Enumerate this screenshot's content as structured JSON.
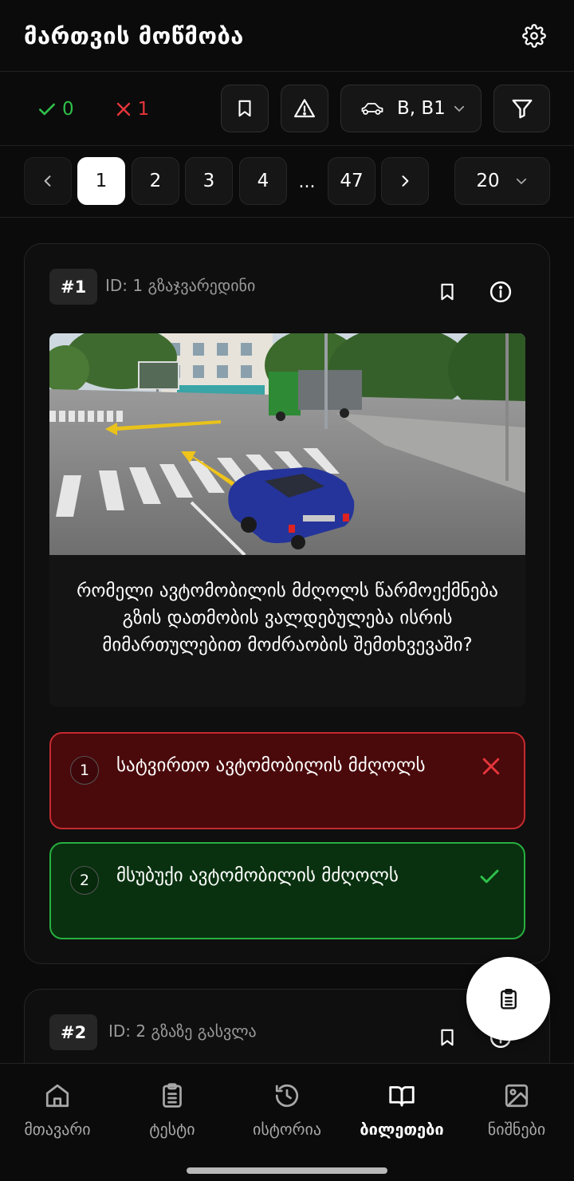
{
  "header": {
    "title": "მართვის მოწმობა",
    "settings_icon": "gear-icon"
  },
  "toolbar": {
    "correct_count": "0",
    "wrong_count": "1",
    "bookmark_icon": "bookmark-icon",
    "warning_icon": "warning-triangle-icon",
    "category_icon": "car-icon",
    "category_value": "B, B1",
    "filter_icon": "filter-icon"
  },
  "pagination": {
    "pages": [
      "1",
      "2",
      "3",
      "4"
    ],
    "ellipsis": "...",
    "last_page": "47",
    "current_page": "1",
    "per_page": "20"
  },
  "questions": [
    {
      "number": "#1",
      "id_label": "ID: 1 გზაჯვარედინი",
      "text": "რომელი ავტომობილის მძღოლს წარმოექმნება გზის დათმობის ვალდებულება ისრის მიმართულებით მოძრაობის შემთხვევაში?",
      "answers": [
        {
          "num": "1",
          "text": "სატვირთო ავტომობილის მძღოლს",
          "status": "wrong"
        },
        {
          "num": "2",
          "text": "მსუბუქი ავტომობილის მძღოლს",
          "status": "correct"
        }
      ]
    },
    {
      "number": "#2",
      "id_label": "ID: 2 გზაზე გასვლა"
    }
  ],
  "colors": {
    "correct": "#2fc04a",
    "wrong": "#e5353b",
    "background": "#0b0b0b"
  },
  "fab": {
    "icon": "clipboard-list-icon"
  },
  "nav": [
    {
      "label": "მთავარი",
      "icon": "home-icon"
    },
    {
      "label": "ტესტი",
      "icon": "clipboard-icon"
    },
    {
      "label": "ისტორია",
      "icon": "history-icon"
    },
    {
      "label": "ბილეთები",
      "icon": "book-open-icon",
      "active": true
    },
    {
      "label": "ნიშნები",
      "icon": "image-icon"
    }
  ]
}
